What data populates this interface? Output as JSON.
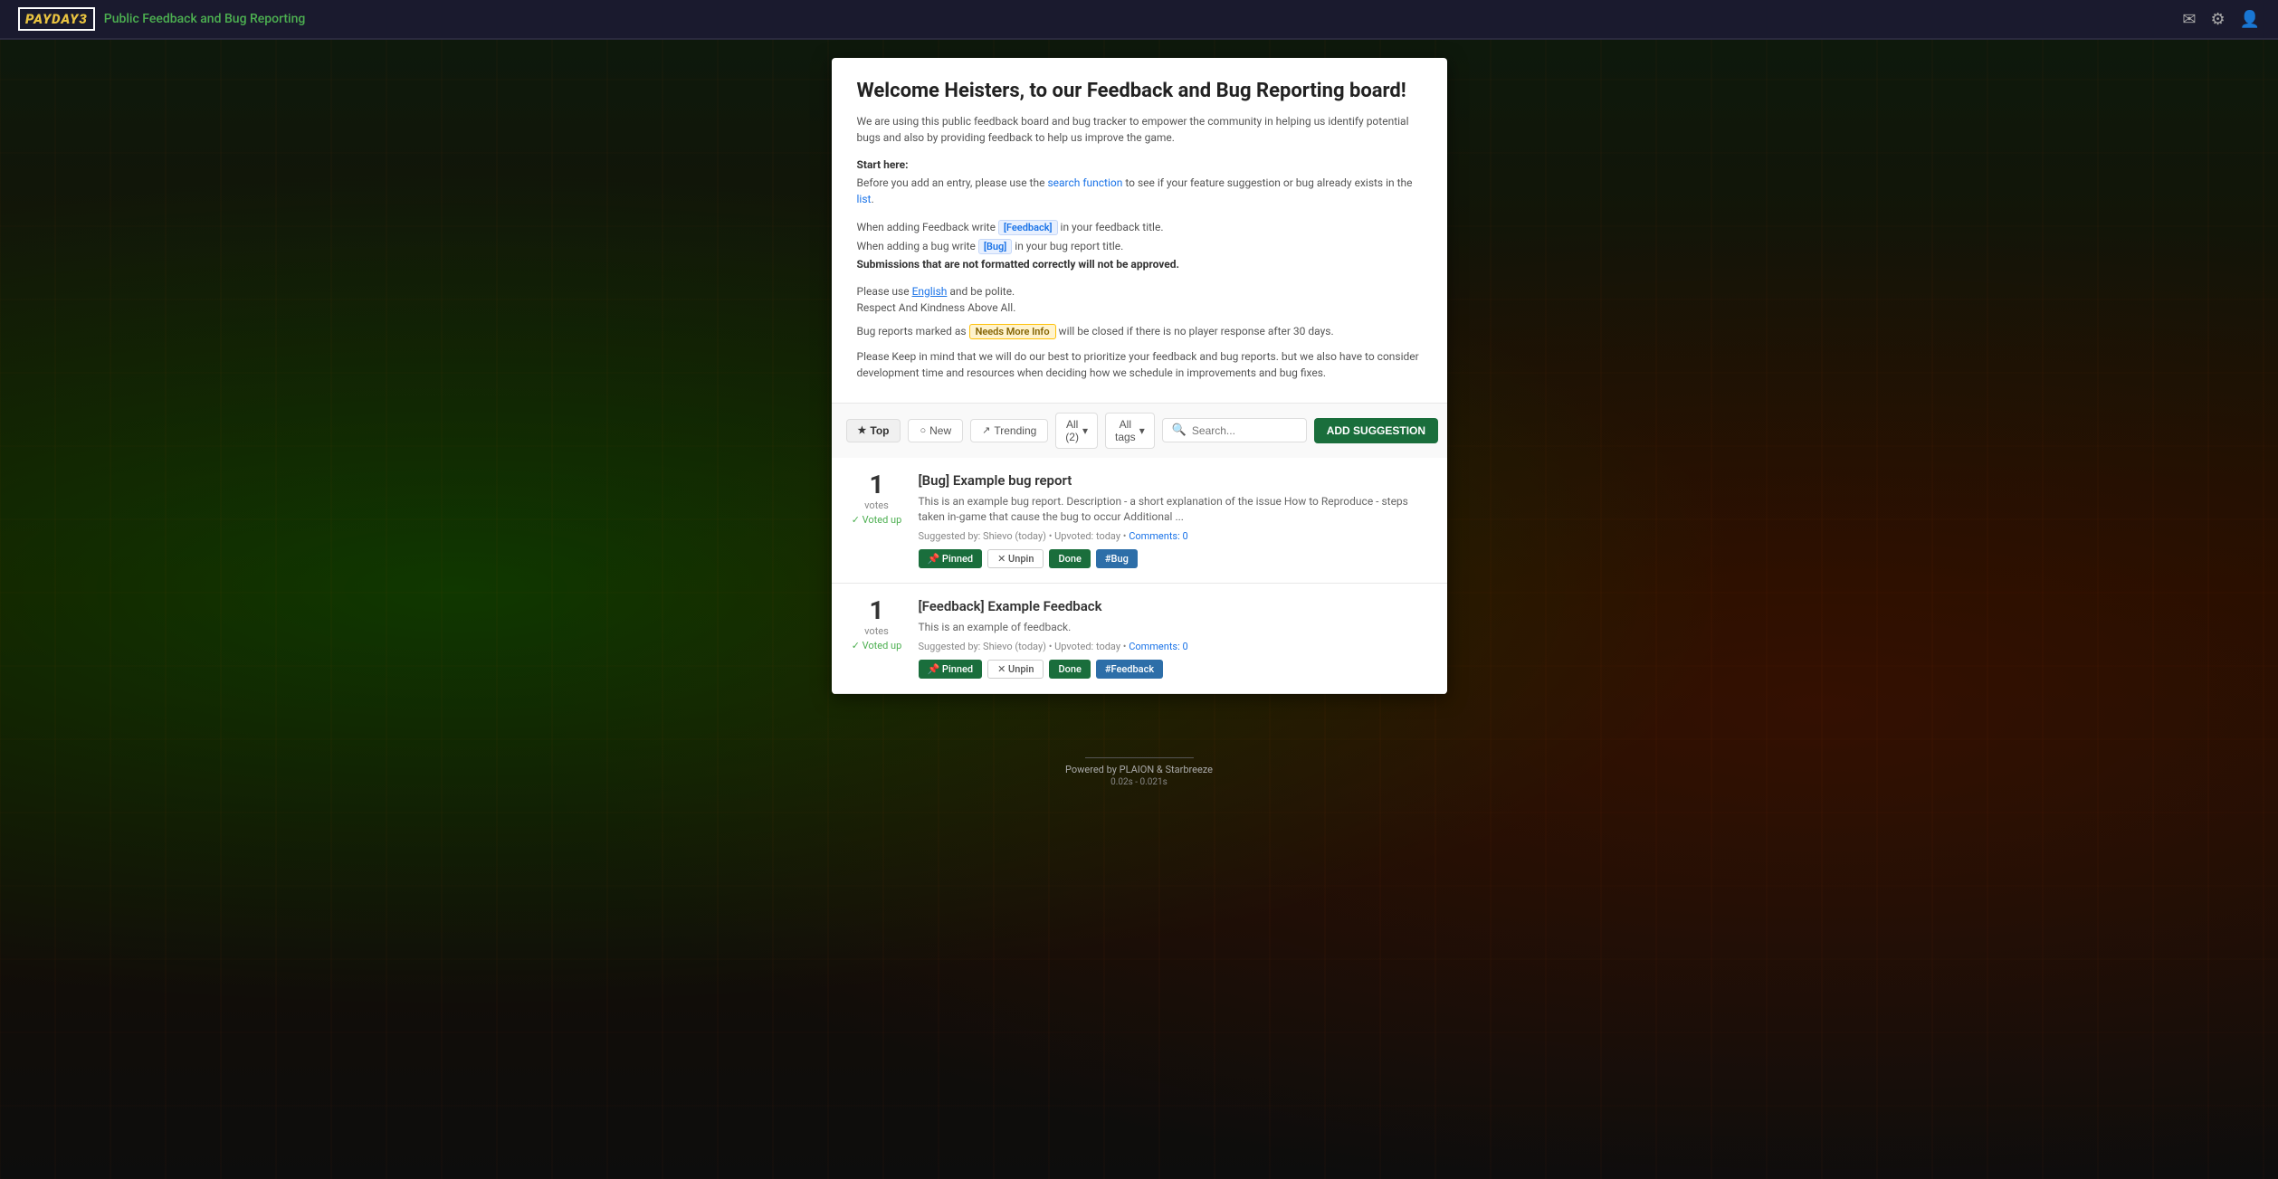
{
  "header": {
    "logo_text": "PAYDAY",
    "logo_number": "3",
    "page_title": "Public Feedback and Bug Reporting",
    "icons": {
      "mail": "✉",
      "settings": "⚙",
      "user": "👤"
    }
  },
  "welcome": {
    "title": "Welcome Heisters, to our Feedback and Bug Reporting board!",
    "description": "We are using this public feedback board and bug tracker to empower the community in helping us identify potential bugs and also by providing feedback to help us improve the game.",
    "start_here_label": "Start here:",
    "search_instruction": "Before you add an entry, please use the search function to see if your feature suggestion or bug already exists in the list.",
    "feedback_instruction": "When adding Feedback write [Feedback] in your feedback title.",
    "bug_instruction": "When adding a bug write [Bug] in your bug report title.",
    "format_warning": "Submissions that are not formatted correctly will not be approved.",
    "language_instruction_prefix": "Please use ",
    "language_link": "English",
    "language_suffix": " and be polite.",
    "respect": "Respect And Kindness Above All.",
    "needs_more_info": "Bug reports marked as Needs More Info will be closed if there is no player response after 30 days.",
    "prioritize_notice": "Please Keep in mind that we will do our best to prioritize your feedback and bug reports. but we also have to consider development time and resources when deciding how we schedule in improvements and bug fixes."
  },
  "toolbar": {
    "tabs": [
      {
        "label": "Top",
        "icon": "★",
        "active": true
      },
      {
        "label": "New",
        "icon": "○",
        "active": false
      },
      {
        "label": "Trending",
        "icon": "↗",
        "active": false
      }
    ],
    "filters": [
      {
        "label": "All (2)",
        "icon": "▾"
      },
      {
        "label": "All tags",
        "icon": "▾"
      }
    ],
    "search_placeholder": "Search...",
    "add_button_label": "ADD SUGGESTION"
  },
  "suggestions": [
    {
      "id": 1,
      "vote_count": "1",
      "votes_label": "votes",
      "voted_up_label": "✓ Voted up",
      "title": "[Bug] Example bug report",
      "description": "This is an example bug report. Description - a short explanation of the issue How to Reproduce - steps taken in-game that cause the bug to occur Additional ...",
      "meta": "Suggested by: Shievo (today) • Upvoted: today • Comments: 0",
      "comments_label": "Comments: 0",
      "tags": [
        {
          "label": "📌 Pinned",
          "type": "pinned"
        },
        {
          "label": "✕ Unpin",
          "type": "unpin"
        },
        {
          "label": "Done",
          "type": "done"
        },
        {
          "label": "#Bug",
          "type": "bug"
        }
      ]
    },
    {
      "id": 2,
      "vote_count": "1",
      "votes_label": "votes",
      "voted_up_label": "✓ Voted up",
      "title": "[Feedback] Example Feedback",
      "description": "This is an example of feedback.",
      "meta": "Suggested by: Shievo (today) • Upvoted: today • Comments: 0",
      "comments_label": "Comments: 0",
      "tags": [
        {
          "label": "📌 Pinned",
          "type": "pinned"
        },
        {
          "label": "✕ Unpin",
          "type": "unpin"
        },
        {
          "label": "Done",
          "type": "done"
        },
        {
          "label": "#Feedback",
          "type": "feedback"
        }
      ]
    }
  ],
  "footer": {
    "powered_by": "Powered by PLAION & Starbreeze",
    "timing": "0.02s - 0.021s"
  }
}
